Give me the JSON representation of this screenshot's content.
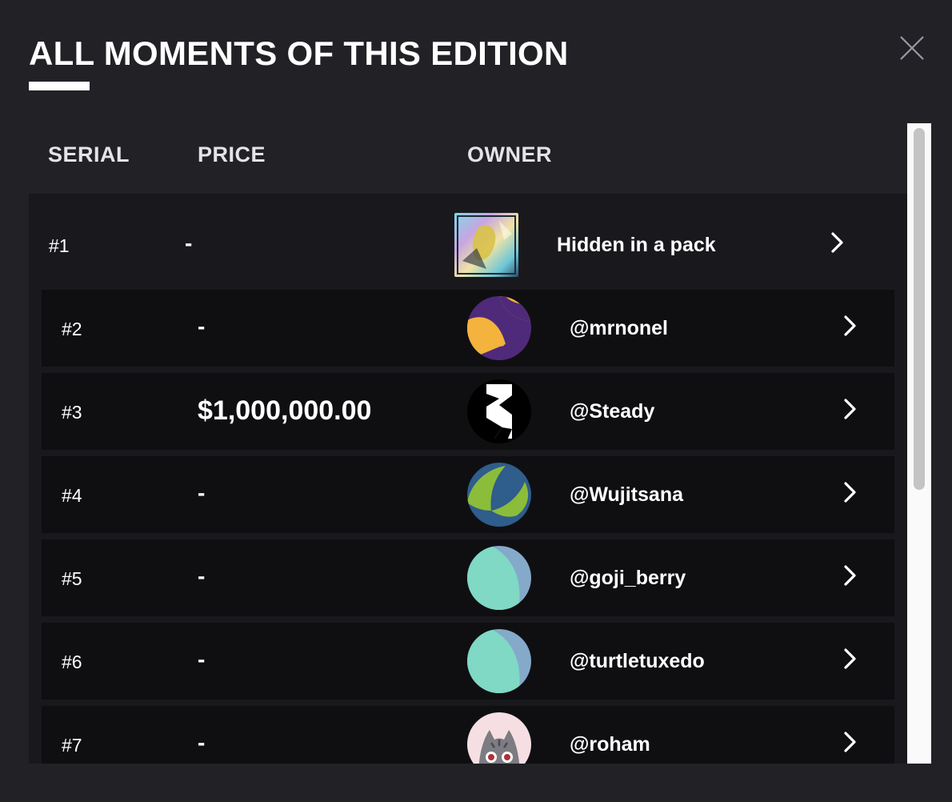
{
  "modal": {
    "title": "ALL MOMENTS OF THIS EDITION"
  },
  "table": {
    "headers": {
      "serial": "SERIAL",
      "price": "PRICE",
      "owner": "OWNER"
    },
    "rows": [
      {
        "serial": "#1",
        "price": "-",
        "owner": "Hidden in a pack",
        "avatar": "pack-card-image"
      },
      {
        "serial": "#2",
        "price": "-",
        "owner": "@mrnonel",
        "avatar": "purple-yellow-avatar"
      },
      {
        "serial": "#3",
        "price": "$1,000,000.00",
        "owner": "@Steady",
        "avatar": "black-white-avatar"
      },
      {
        "serial": "#4",
        "price": "-",
        "owner": "@Wujitsana",
        "avatar": "blue-green-avatar"
      },
      {
        "serial": "#5",
        "price": "-",
        "owner": "@goji_berry",
        "avatar": "teal-avatar"
      },
      {
        "serial": "#6",
        "price": "-",
        "owner": "@turtletuxedo",
        "avatar": "teal-avatar"
      },
      {
        "serial": "#7",
        "price": "-",
        "owner": "@roham",
        "avatar": "cat-avatar"
      }
    ]
  },
  "icons": {
    "close": "close-icon",
    "row_action": "chevron-right-icon"
  },
  "colors": {
    "background": "#212126",
    "row": "#0f0f12",
    "text": "#ffffff"
  }
}
